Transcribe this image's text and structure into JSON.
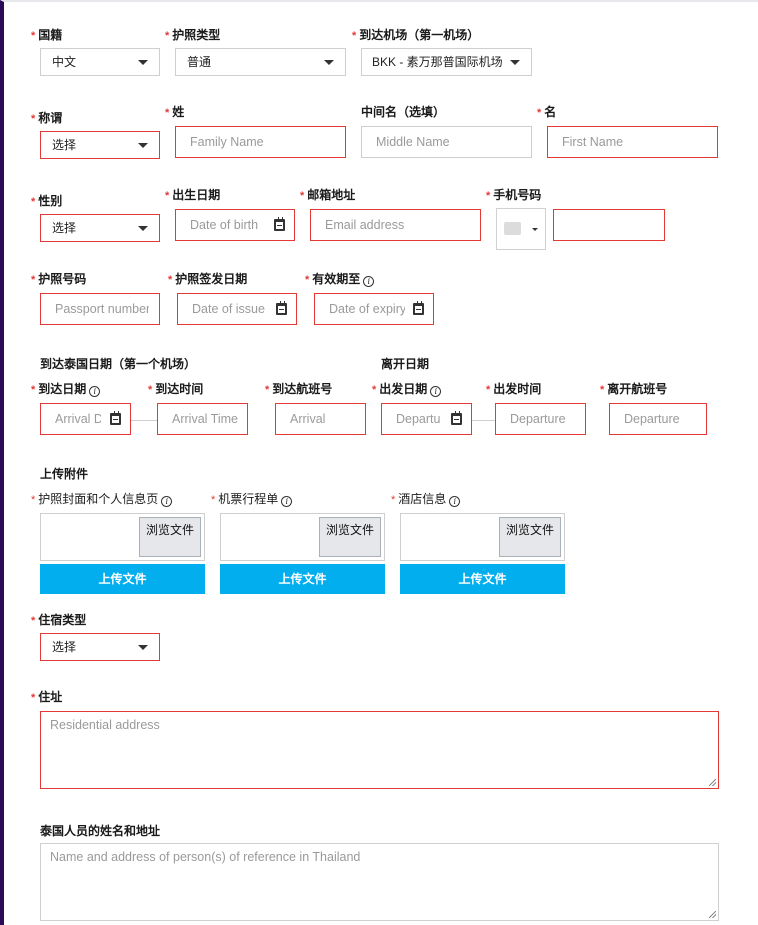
{
  "colors": {
    "required": "#e53935",
    "upload_button": "#03aeef",
    "left_border": "#2b0a57"
  },
  "row1": {
    "nationality": {
      "label": "国籍",
      "value": "中文"
    },
    "passport_type": {
      "label": "护照类型",
      "value": "普通"
    },
    "arrival_airport": {
      "label": "到达机场（第一机场）",
      "value": "BKK - 素万那普国际机场"
    }
  },
  "row2": {
    "title": {
      "label": "称谓",
      "value": "选择"
    },
    "family_name": {
      "label": "姓",
      "placeholder": "Family Name"
    },
    "middle_name": {
      "label": "中间名（选填）",
      "placeholder": "Middle Name"
    },
    "first_name": {
      "label": "名",
      "placeholder": "First Name"
    }
  },
  "row3": {
    "gender": {
      "label": "性别",
      "value": "选择"
    },
    "dob": {
      "label": "出生日期",
      "placeholder": "Date of birth"
    },
    "email": {
      "label": "邮箱地址",
      "placeholder": "Email address"
    },
    "phone": {
      "label": "手机号码",
      "placeholder": ""
    }
  },
  "row4": {
    "passport_no": {
      "label": "护照号码",
      "placeholder": "Passport number"
    },
    "issue_date": {
      "label": "护照签发日期",
      "placeholder": "Date of issue"
    },
    "expiry_date": {
      "label": "有效期至",
      "placeholder": "Date of expiry"
    }
  },
  "arrival": {
    "section": "到达泰国日期（第一个机场）",
    "date": {
      "label": "到达日期",
      "placeholder": "Arrival Date"
    },
    "time": {
      "label": "到达时间",
      "placeholder": "Arrival Time"
    },
    "flight": {
      "label": "到达航班号",
      "placeholder": "Arrival"
    }
  },
  "departure": {
    "section": "离开日期",
    "date": {
      "label": "出发日期",
      "placeholder": "Departure"
    },
    "time": {
      "label": "出发时间",
      "placeholder": "Departure"
    },
    "flight": {
      "label": "离开航班号",
      "placeholder": "Departure"
    }
  },
  "attachments": {
    "section": "上传附件",
    "browse_label": "浏览文件",
    "upload_label": "上传文件",
    "items": [
      {
        "label": "护照封面和个人信息页"
      },
      {
        "label": "机票行程单"
      },
      {
        "label": "酒店信息"
      }
    ]
  },
  "accommodation": {
    "label": "住宿类型",
    "value": "选择"
  },
  "address": {
    "label": "住址",
    "placeholder": "Residential address"
  },
  "reference": {
    "label": "泰国人员的姓名和地址",
    "placeholder": "Name and address of person(s) of reference in Thailand"
  }
}
